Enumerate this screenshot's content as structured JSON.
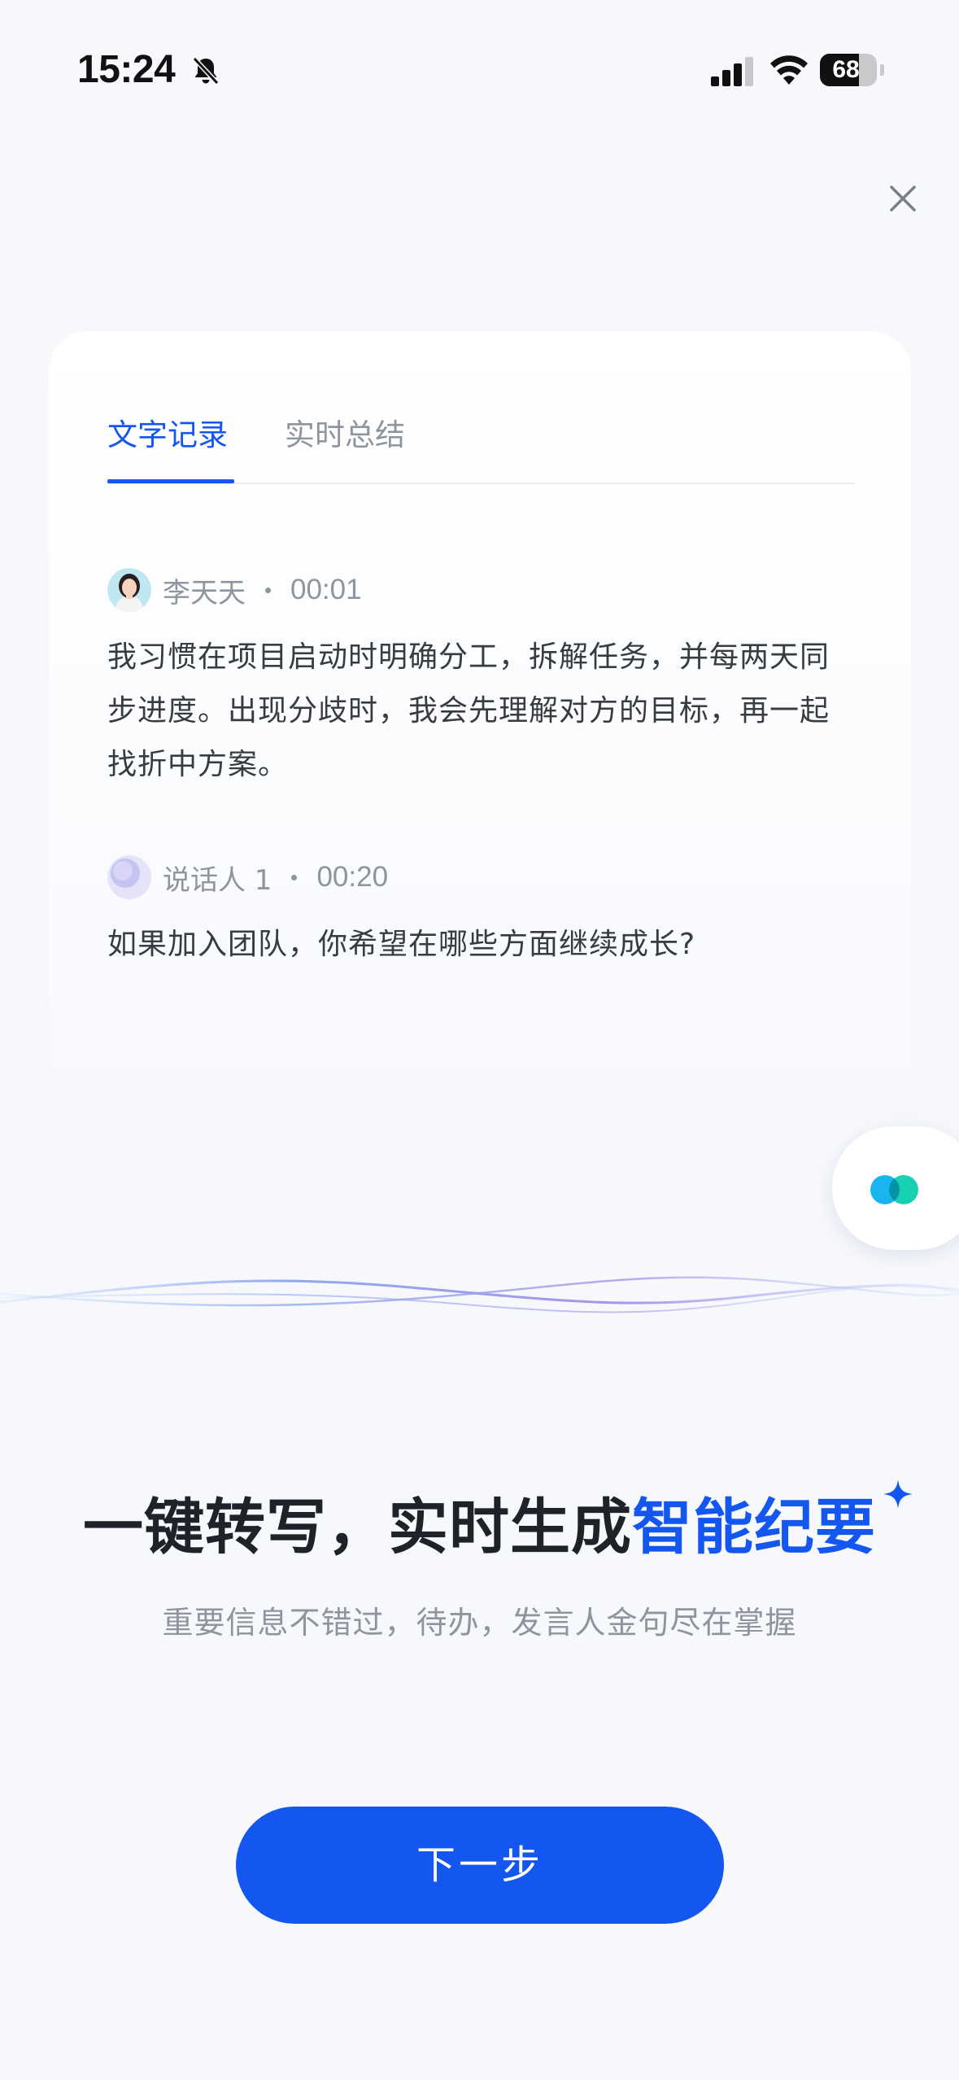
{
  "status_bar": {
    "time": "15:24",
    "battery_level": "68",
    "battery_fraction": 0.68
  },
  "icons": {
    "bell": "bell-slash-icon",
    "signal": "cellular-signal-icon",
    "wifi": "wifi-icon",
    "close": "close-icon",
    "sparkle": "sparkle-icon"
  },
  "card": {
    "tabs": [
      {
        "label": "文字记录",
        "active": true
      },
      {
        "label": "实时总结",
        "active": false
      }
    ],
    "entries": [
      {
        "speaker": "李天天",
        "time": "00:01",
        "text": "我习惯在项目启动时明确分工，拆解任务，并每两天同步进度。出现分歧时，我会先理解对方的目标，再一起找折中方案。"
      },
      {
        "speaker": "说话人 1",
        "time": "00:20",
        "text": "如果加入团队，你希望在哪些方面继续成长?"
      }
    ]
  },
  "headline": {
    "part1": "一键转写，实时生成",
    "accent": "智能纪要"
  },
  "subtitle": "重要信息不错过，待办，发言人金句尽在掌握",
  "cta": {
    "label": "下一步"
  },
  "colors": {
    "accent": "#1456f0",
    "background": "#f6f8fc",
    "text_primary": "#1f2329",
    "text_secondary": "#8f959e"
  }
}
